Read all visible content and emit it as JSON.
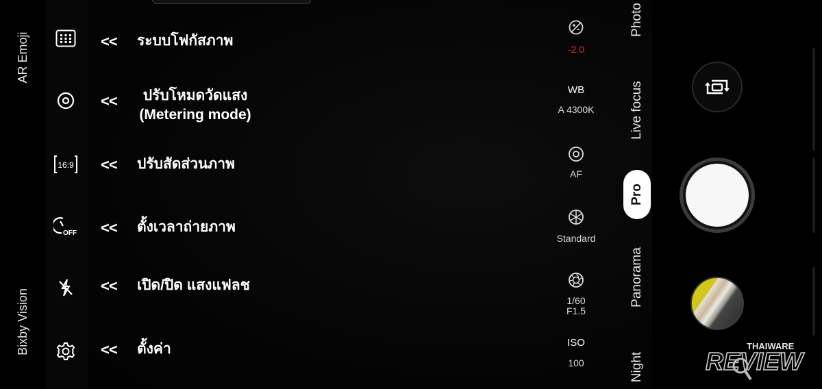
{
  "left_modes": {
    "ar_emoji": "AR Emoji",
    "bixby_vision": "Bixby Vision"
  },
  "annotations": [
    {
      "icon": "grid-icon",
      "arrow": "<<",
      "text": "ระบบโฟกัสภาพ"
    },
    {
      "icon": "metering-icon",
      "arrow": "<<",
      "text": "ปรับโหมดวัดแสง",
      "text2": "(Metering mode)"
    },
    {
      "icon": "ratio-icon",
      "arrow": "<<",
      "text": "ปรับสัดส่วนภาพ",
      "icon_text": "16:9"
    },
    {
      "icon": "timer-off-icon",
      "arrow": "<<",
      "text": "ตั้งเวลาถ่ายภาพ",
      "icon_text": "OFF"
    },
    {
      "icon": "flash-off-icon",
      "arrow": "<<",
      "text": "เปิด/ปิด แสงแฟลช"
    },
    {
      "icon": "settings-icon",
      "arrow": "<<",
      "text": "ตั้งค่า"
    }
  ],
  "pro_settings": {
    "exposure": {
      "icon": "exposure-icon",
      "value": "-2.0",
      "color": "#c0392b"
    },
    "white_balance": {
      "label": "WB",
      "value": "A 4300K"
    },
    "focus": {
      "icon": "focus-icon",
      "value": "AF"
    },
    "color_tone": {
      "icon": "aperture-icon",
      "value": "Standard"
    },
    "shutter": {
      "icon": "shutter-speed-icon",
      "value": "1/60",
      "value2": "F1.5"
    },
    "iso": {
      "label": "ISO",
      "value": "100"
    }
  },
  "camera_modes": [
    "Photo",
    "Live focus",
    "Pro",
    "Panorama",
    "Night"
  ],
  "active_mode": "Pro",
  "watermark": {
    "top": "THAIWARE",
    "bottom": "REVIEW"
  },
  "colors": {
    "background": "#000000",
    "active_mode_bg": "#ffffff",
    "exposure_value": "#c0392b"
  }
}
